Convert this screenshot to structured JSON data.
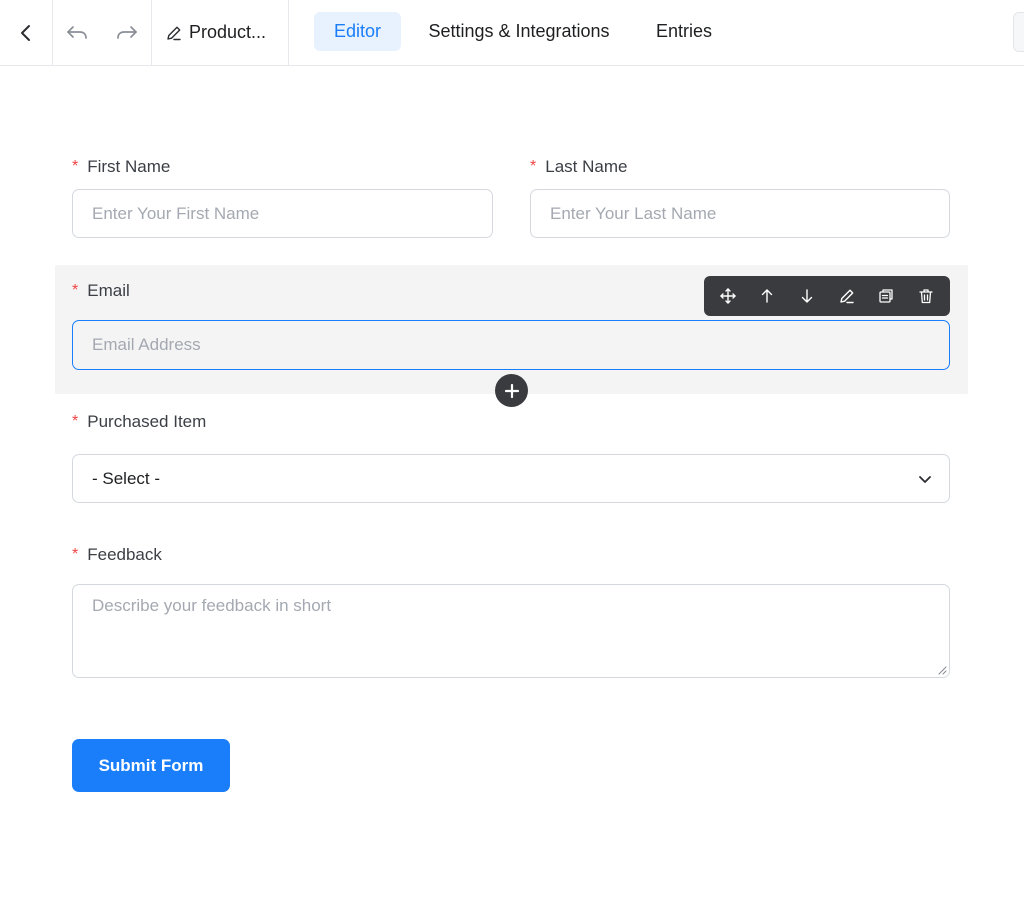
{
  "header": {
    "form_title": "Product...",
    "tabs": [
      {
        "label": "Editor",
        "active": true
      },
      {
        "label": "Settings & Integrations",
        "active": false
      },
      {
        "label": "Entries",
        "active": false
      }
    ]
  },
  "form": {
    "required_mark": "*",
    "first_name": {
      "label": "First Name",
      "placeholder": "Enter Your First Name"
    },
    "last_name": {
      "label": "Last Name",
      "placeholder": "Enter Your Last Name"
    },
    "email": {
      "label": "Email",
      "placeholder": "Email Address"
    },
    "purchased_item": {
      "label": "Purchased Item",
      "selected": "- Select -"
    },
    "feedback": {
      "label": "Feedback",
      "placeholder": "Describe your feedback in short"
    },
    "submit_label": "Submit Form"
  },
  "field_toolbar": {
    "icons": [
      "move-icon",
      "arrow-up-icon",
      "arrow-down-icon",
      "pencil-icon",
      "duplicate-icon",
      "trash-icon"
    ]
  },
  "colors": {
    "accent": "#1a7efb",
    "active_tab_bg": "#e8f2fe",
    "required": "#ef4444",
    "toolbar_bg": "#3a3b3e"
  }
}
